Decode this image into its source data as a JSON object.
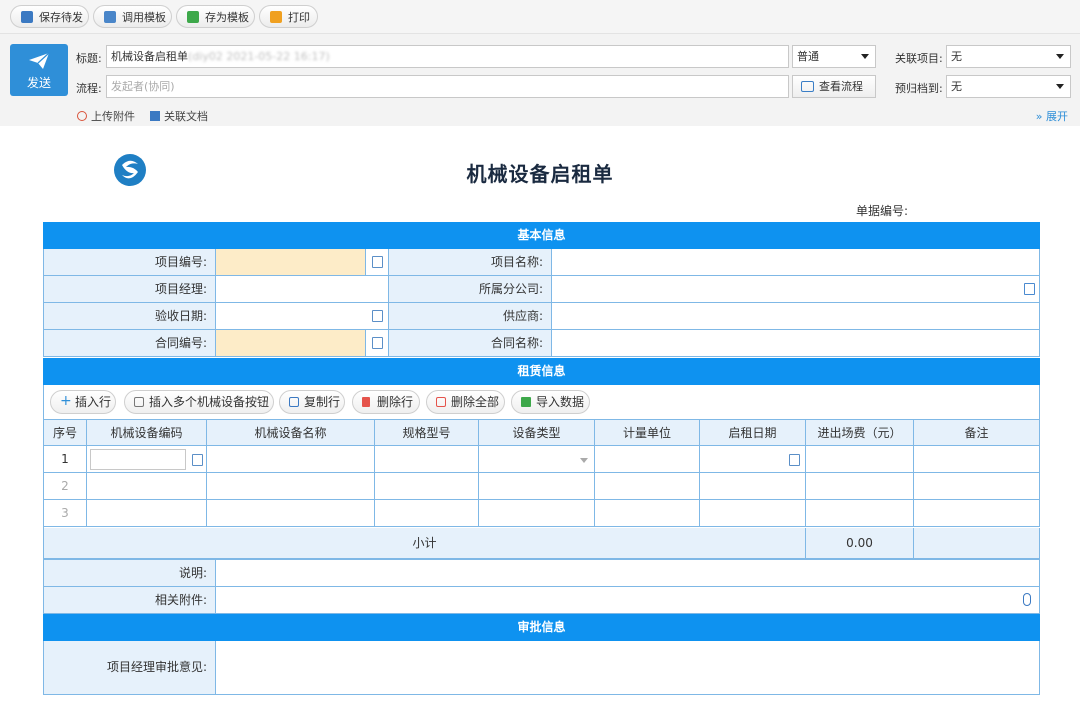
{
  "toolbar": {
    "buttons": [
      {
        "label": "保存待发",
        "icon": "save-icon"
      },
      {
        "label": "调用模板",
        "icon": "template-load-icon"
      },
      {
        "label": "存为模板",
        "icon": "template-save-icon"
      },
      {
        "label": "打印",
        "icon": "print-icon"
      }
    ]
  },
  "header": {
    "send_label": "发送",
    "title_label": "标题:",
    "title_value": "机械设备启租单",
    "title_blurred": "(diy02 2021-05-22 16:17)",
    "flow_label": "流程:",
    "flow_placeholder": "发起者(协同)",
    "priority_value": "普通",
    "view_flow_label": "查看流程",
    "related_project_label": "关联项目:",
    "related_project_value": "无",
    "archive_label": "预归档到:",
    "archive_value": "无",
    "upload_label": "上传附件",
    "related_doc_label": "关联文档",
    "expand_label": "展开"
  },
  "form": {
    "title": "机械设备启租单",
    "doc_no_label": "单据编号:",
    "basic_section": "基本信息",
    "basic_rows": [
      {
        "l1": "项目编号:",
        "l2": "项目名称:"
      },
      {
        "l1": "项目经理:",
        "l2": "所属分公司:"
      },
      {
        "l1": "验收日期:",
        "l2": "供应商:"
      },
      {
        "l1": "合同编号:",
        "l2": "合同名称:"
      }
    ],
    "lease_section": "租赁信息",
    "actions": [
      "插入行",
      "插入多个机械设备按钮",
      "复制行",
      "删除行",
      "删除全部",
      "导入数据"
    ],
    "columns": [
      "序号",
      "机械设备编码",
      "机械设备名称",
      "规格型号",
      "设备类型",
      "计量单位",
      "启租日期",
      "进出场费（元）",
      "备注"
    ],
    "row_numbers": [
      "1",
      "2",
      "3"
    ],
    "subtotal_label": "小计",
    "subtotal_value": "0.00",
    "note_label": "说明:",
    "attachment_label": "相关附件:",
    "approval_section": "审批信息",
    "approval_label": "项目经理审批意见:"
  },
  "colors": {
    "accent": "#0e92f0",
    "label_bg": "#e6f1fb",
    "required_bg": "#fdecc8",
    "send_bg": "#2f8fd8"
  }
}
